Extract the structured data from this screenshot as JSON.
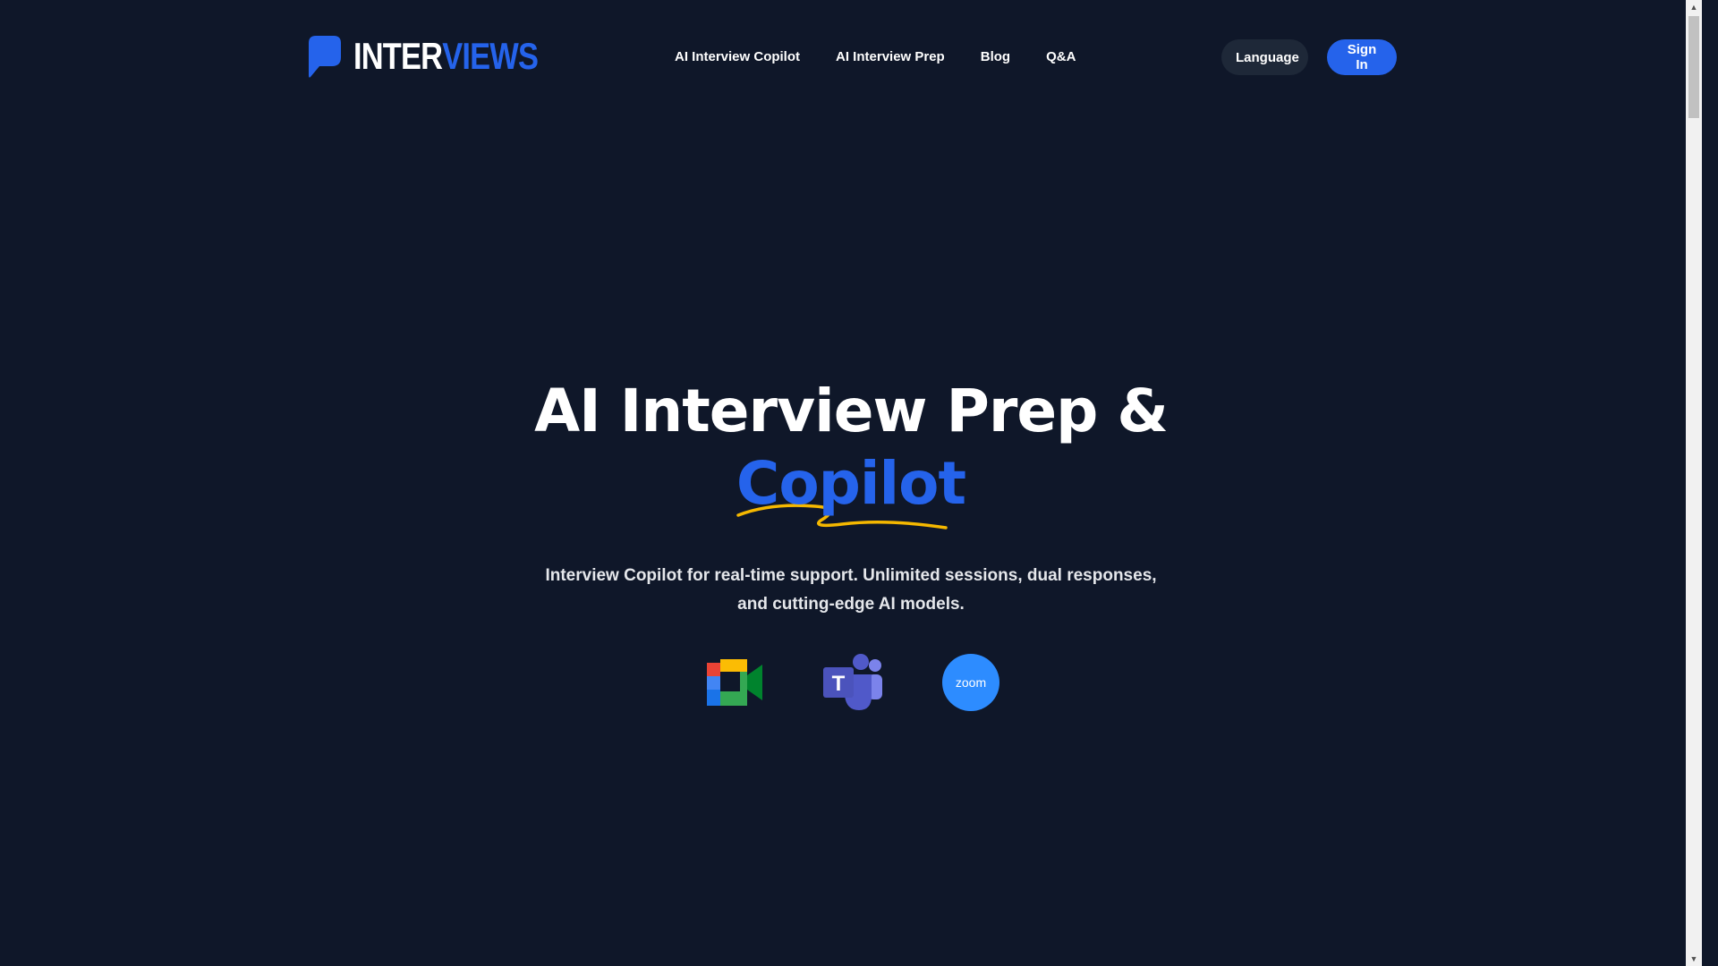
{
  "brand": {
    "logo_part1": "INTER",
    "logo_part2": "VIEWS",
    "accent_color": "#2563eb",
    "background_color": "#0f1729"
  },
  "nav": {
    "items": [
      {
        "label": "AI Interview Copilot"
      },
      {
        "label": "AI Interview Prep"
      },
      {
        "label": "Blog"
      },
      {
        "label": "Q&A"
      }
    ]
  },
  "header_actions": {
    "language_label": "Language",
    "signin_label": "Sign In"
  },
  "hero": {
    "title_line1": "AI Interview Prep &",
    "title_line2": "Copilot",
    "underline_color": "#f5b800",
    "subtitle_line1": "Interview Copilot for real-time support. Unlimited sessions, dual responses,",
    "subtitle_line2": "and cutting-edge AI models."
  },
  "platforms": [
    {
      "icon": "google-meet-icon"
    },
    {
      "icon": "microsoft-teams-icon"
    },
    {
      "icon": "zoom-icon",
      "text": "zoom"
    }
  ]
}
